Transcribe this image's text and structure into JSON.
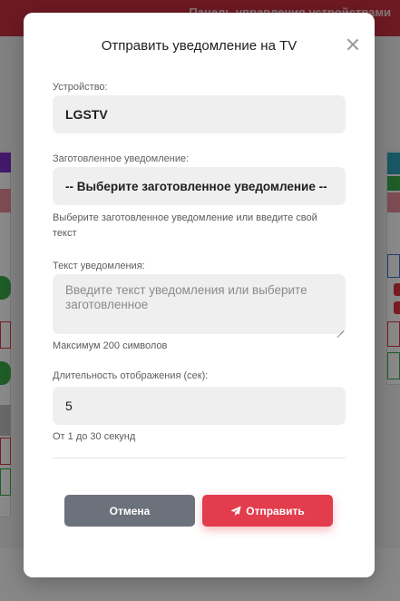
{
  "background": {
    "topbar_title": "Панель управления устройствами"
  },
  "modal": {
    "title": "Отправить уведомление на TV",
    "device": {
      "label": "Устройство:",
      "value": "LGSTV"
    },
    "preset": {
      "label": "Заготовленное уведомление:",
      "selected": "-- Выберите заготовленное уведомление --",
      "hint": "Выберите заготовленное уведомление или введите свой текст"
    },
    "message": {
      "label": "Текст уведомления:",
      "placeholder": "Введите текст уведомления или выберите заготовленное",
      "hint": "Максимум 200 символов"
    },
    "duration": {
      "label": "Длительность отображения (сек):",
      "value": "5",
      "hint": "От 1 до 30 секунд"
    },
    "buttons": {
      "cancel": "Отмена",
      "send": "Отправить"
    }
  },
  "colors": {
    "brand_red": "#c9303f",
    "send_button": "#e23c4d",
    "cancel_button": "#6c727c",
    "field_background": "#efefef"
  },
  "icons": {
    "close": "close-icon",
    "send": "paper-plane-icon"
  }
}
